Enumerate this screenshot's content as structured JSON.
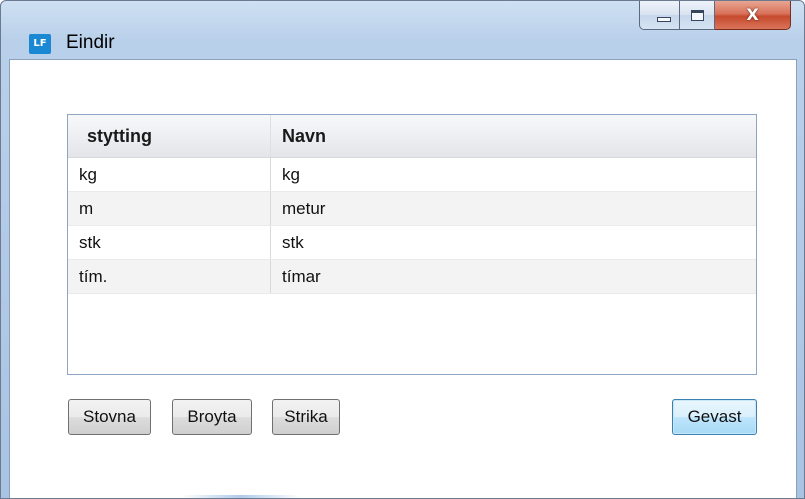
{
  "window": {
    "title": "Eindir",
    "icon_text": "LF",
    "controls": {
      "minimize_icon": "minimize-icon",
      "maximize_icon": "maximize-icon",
      "close_icon": "close-icon",
      "close_glyph": "X"
    }
  },
  "grid": {
    "columns": [
      "stytting",
      "Navn"
    ],
    "rows": [
      {
        "stytting": "kg",
        "navn": "kg"
      },
      {
        "stytting": "m",
        "navn": "metur"
      },
      {
        "stytting": "stk",
        "navn": "stk"
      },
      {
        "stytting": "tím.",
        "navn": "tímar"
      }
    ]
  },
  "buttons": {
    "new": "Stovna",
    "edit": "Broyta",
    "delete": "Strika",
    "save": "Gevast"
  },
  "colors": {
    "accent": "#1b88d4",
    "close_button": "#c64a2d",
    "default_button_border": "#3c7fb1"
  }
}
